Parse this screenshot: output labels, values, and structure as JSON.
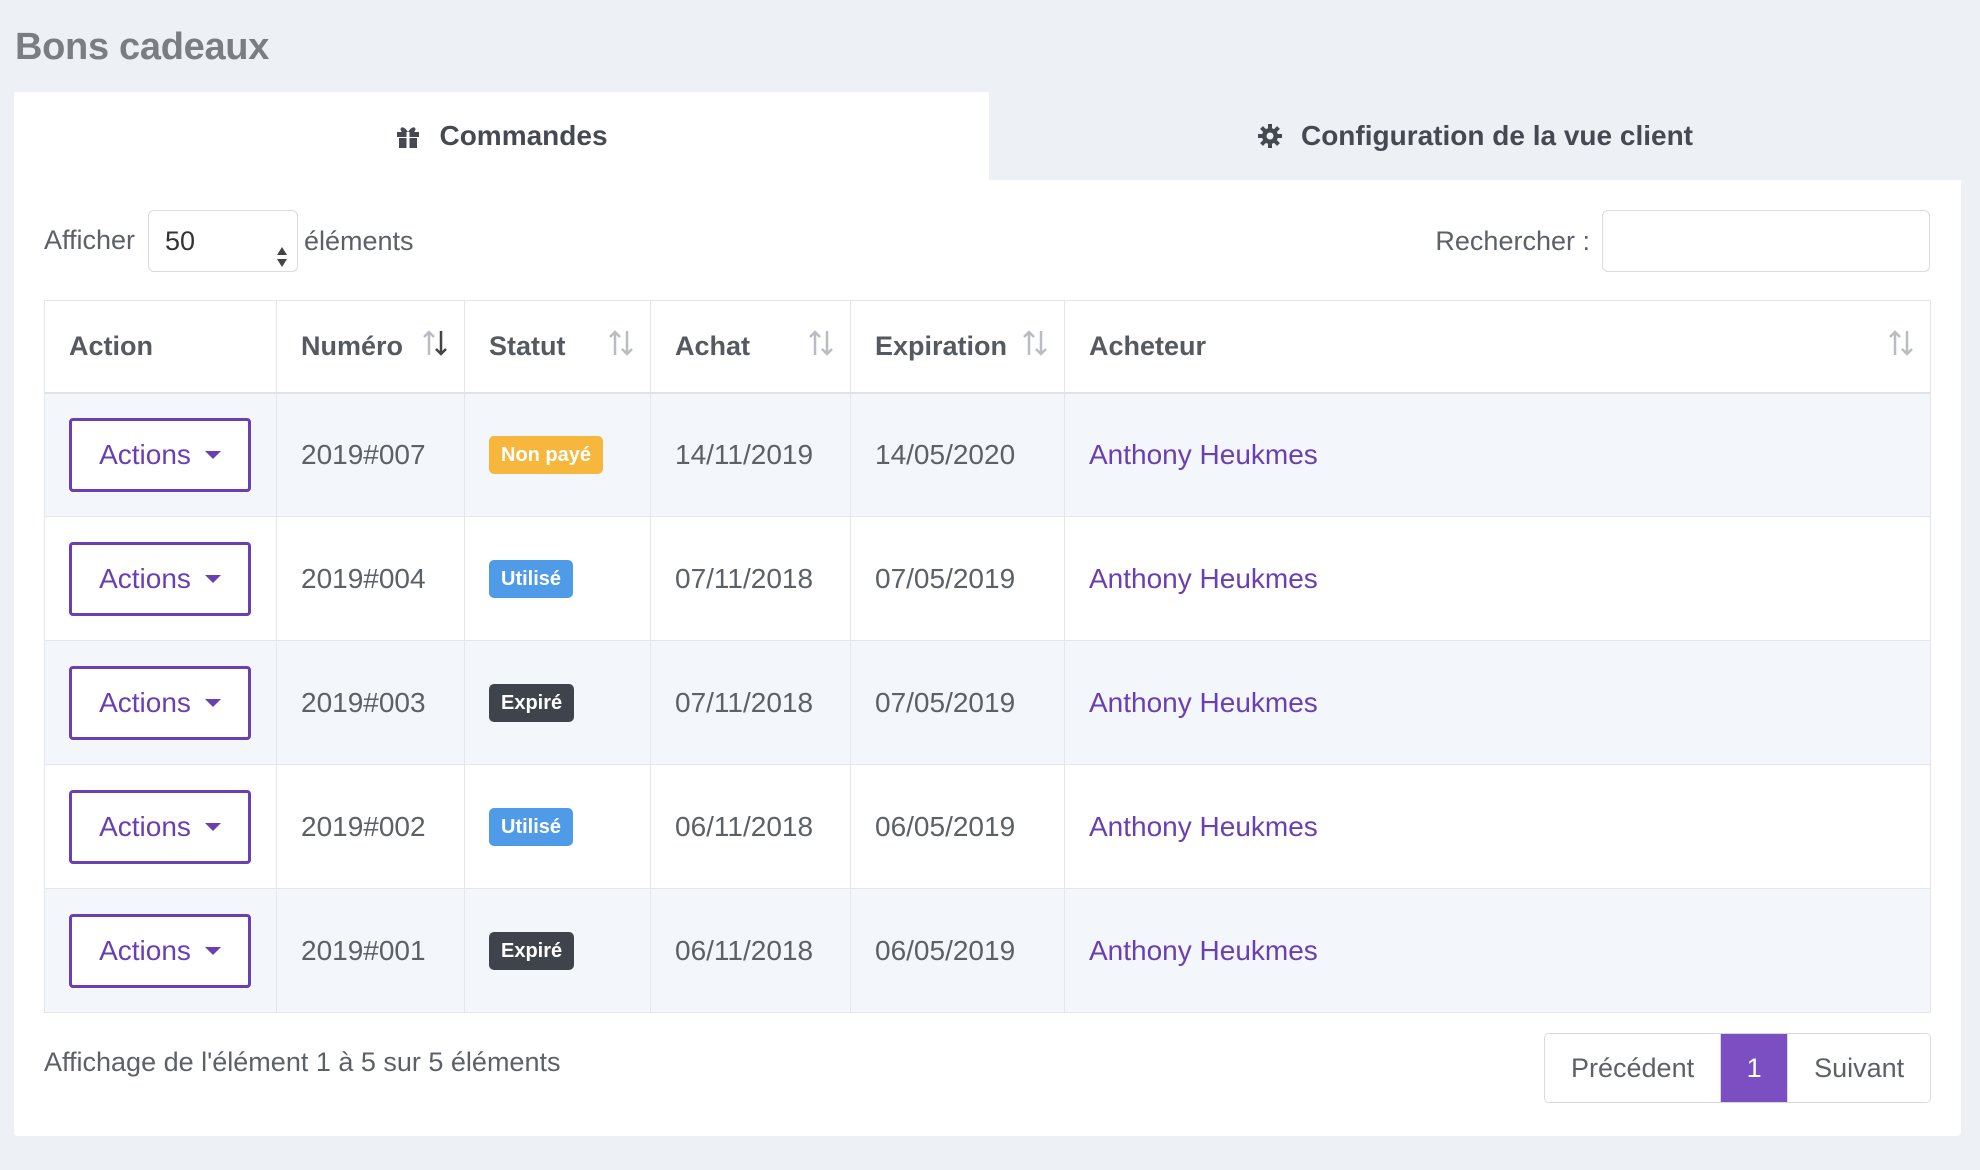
{
  "page": {
    "title": "Bons cadeaux"
  },
  "tabs": [
    {
      "label": "Commandes",
      "icon": "gift-icon",
      "active": true
    },
    {
      "label": "Configuration de la vue client",
      "icon": "gear-icon",
      "active": false
    }
  ],
  "controls": {
    "show_label": "Afficher",
    "page_length": "50",
    "elements_label": "éléments",
    "search_label": "Rechercher :",
    "search_value": ""
  },
  "table": {
    "columns": [
      "Action",
      "Numéro",
      "Statut",
      "Achat",
      "Expiration",
      "Acheteur"
    ],
    "action_label": "Actions",
    "rows": [
      {
        "numero": "2019#007",
        "statut": "Non payé",
        "statut_color": "#f6b73c",
        "achat": "14/11/2019",
        "expiration": "14/05/2020",
        "acheteur": "Anthony Heukmes"
      },
      {
        "numero": "2019#004",
        "statut": "Utilisé",
        "statut_color": "#4f9be8",
        "achat": "07/11/2018",
        "expiration": "07/05/2019",
        "acheteur": "Anthony Heukmes"
      },
      {
        "numero": "2019#003",
        "statut": "Expiré",
        "statut_color": "#3f434b",
        "achat": "07/11/2018",
        "expiration": "07/05/2019",
        "acheteur": "Anthony Heukmes"
      },
      {
        "numero": "2019#002",
        "statut": "Utilisé",
        "statut_color": "#4f9be8",
        "achat": "06/11/2018",
        "expiration": "06/05/2019",
        "acheteur": "Anthony Heukmes"
      },
      {
        "numero": "2019#001",
        "statut": "Expiré",
        "statut_color": "#3f434b",
        "achat": "06/11/2018",
        "expiration": "06/05/2019",
        "acheteur": "Anthony Heukmes"
      }
    ]
  },
  "footer": {
    "info": "Affichage de l'élément 1 à 5 sur 5 éléments",
    "prev_label": "Précédent",
    "current_page": "1",
    "next_label": "Suivant"
  },
  "colors": {
    "accent": "#6a3fb3",
    "page_active": "#7b4fc2"
  }
}
